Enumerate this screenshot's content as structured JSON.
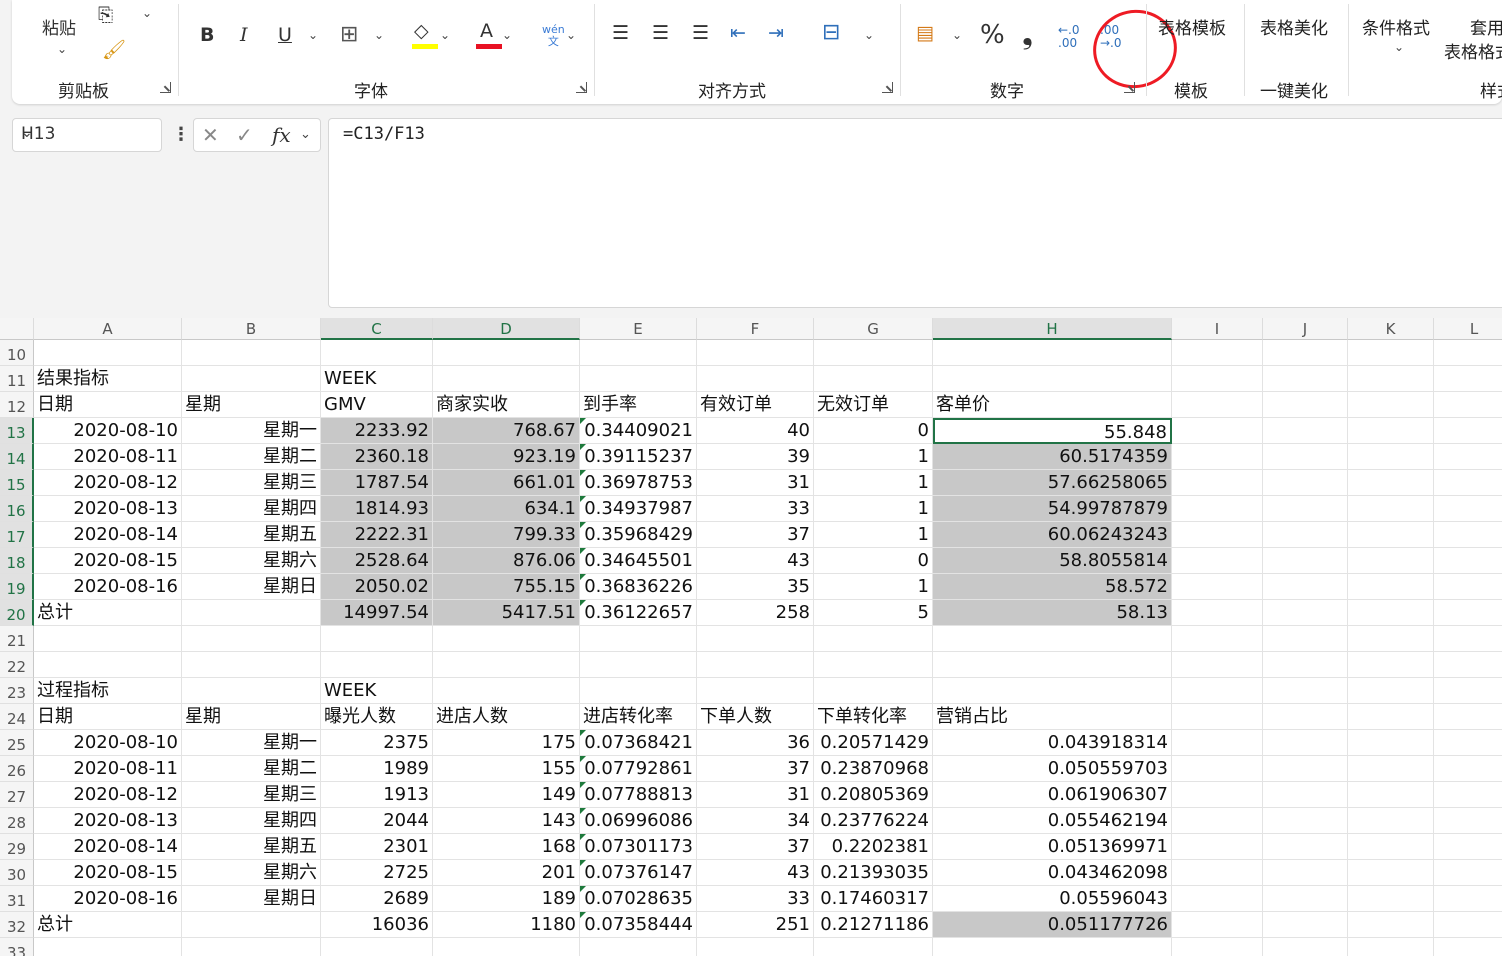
{
  "ribbon": {
    "groups": {
      "clipboard": "剪贴板",
      "font": "字体",
      "align": "对齐方式",
      "number": "数字",
      "template": "模板",
      "beautify": "一键美化",
      "style": "样式"
    },
    "paste_label": "粘贴",
    "bold": "B",
    "italic": "I",
    "underline": "U",
    "font_color_glyph": "A",
    "phonetic_top": "wén",
    "phonetic_bottom": "文",
    "percent": "%",
    "comma": "❟",
    "inc_decimal_top": "←.0",
    "inc_decimal_bottom": ".00",
    "dec_decimal_top": ".00",
    "dec_decimal_bottom": "→.0",
    "table_template": "表格模板",
    "table_beautify": "表格美化",
    "conditional_format": "条件格式",
    "apply_format_top": "套用",
    "apply_format_bottom": "表格格式",
    "highlight_color": "#ffff00",
    "font_color": "#e81123",
    "annotation_color": "#ee1b24"
  },
  "formula_bar": {
    "name_box": "H13",
    "fx": "fx",
    "formula": "=C13/F13"
  },
  "sheet": {
    "columns": [
      "A",
      "B",
      "C",
      "D",
      "E",
      "F",
      "G",
      "H",
      "I",
      "J",
      "K",
      "L"
    ],
    "rows": [
      {
        "n": "10",
        "cells": [
          "",
          "",
          "",
          "",
          "",
          "",
          "",
          ""
        ]
      },
      {
        "n": "11",
        "cells": [
          "结果指标",
          "",
          "WEEK",
          "",
          "",
          "",
          "",
          ""
        ]
      },
      {
        "n": "12",
        "cells": [
          "日期",
          "星期",
          "GMV",
          "商家实收",
          "到手率",
          "有效订单",
          "无效订单",
          "客单价"
        ]
      },
      {
        "n": "13",
        "cells": [
          "2020-08-10",
          "星期一",
          "2233.92",
          "768.67",
          "0.34409021",
          "40",
          "0",
          "55.848"
        ]
      },
      {
        "n": "14",
        "cells": [
          "2020-08-11",
          "星期二",
          "2360.18",
          "923.19",
          "0.39115237",
          "39",
          "1",
          "60.5174359"
        ]
      },
      {
        "n": "15",
        "cells": [
          "2020-08-12",
          "星期三",
          "1787.54",
          "661.01",
          "0.36978753",
          "31",
          "1",
          "57.66258065"
        ]
      },
      {
        "n": "16",
        "cells": [
          "2020-08-13",
          "星期四",
          "1814.93",
          "634.1",
          "0.34937987",
          "33",
          "1",
          "54.99787879"
        ]
      },
      {
        "n": "17",
        "cells": [
          "2020-08-14",
          "星期五",
          "2222.31",
          "799.33",
          "0.35968429",
          "37",
          "1",
          "60.06243243"
        ]
      },
      {
        "n": "18",
        "cells": [
          "2020-08-15",
          "星期六",
          "2528.64",
          "876.06",
          "0.34645501",
          "43",
          "0",
          "58.8055814"
        ]
      },
      {
        "n": "19",
        "cells": [
          "2020-08-16",
          "星期日",
          "2050.02",
          "755.15",
          "0.36836226",
          "35",
          "1",
          "58.572"
        ]
      },
      {
        "n": "20",
        "cells": [
          "总计",
          "",
          "14997.54",
          "5417.51",
          "0.36122657",
          "258",
          "5",
          "58.13"
        ]
      },
      {
        "n": "21",
        "cells": [
          "",
          "",
          "",
          "",
          "",
          "",
          "",
          ""
        ]
      },
      {
        "n": "22",
        "cells": [
          "",
          "",
          "",
          "",
          "",
          "",
          "",
          ""
        ]
      },
      {
        "n": "23",
        "cells": [
          "过程指标",
          "",
          "WEEK",
          "",
          "",
          "",
          "",
          ""
        ]
      },
      {
        "n": "24",
        "cells": [
          "日期",
          "星期",
          "曝光人数",
          "进店人数",
          "进店转化率",
          "下单人数",
          "下单转化率",
          "营销占比"
        ]
      },
      {
        "n": "25",
        "cells": [
          "2020-08-10",
          "星期一",
          "2375",
          "175",
          "0.07368421",
          "36",
          "0.20571429",
          "0.043918314"
        ]
      },
      {
        "n": "26",
        "cells": [
          "2020-08-11",
          "星期二",
          "1989",
          "155",
          "0.07792861",
          "37",
          "0.23870968",
          "0.050559703"
        ]
      },
      {
        "n": "27",
        "cells": [
          "2020-08-12",
          "星期三",
          "1913",
          "149",
          "0.07788813",
          "31",
          "0.20805369",
          "0.061906307"
        ]
      },
      {
        "n": "28",
        "cells": [
          "2020-08-13",
          "星期四",
          "2044",
          "143",
          "0.06996086",
          "34",
          "0.23776224",
          "0.055462194"
        ]
      },
      {
        "n": "29",
        "cells": [
          "2020-08-14",
          "星期五",
          "2301",
          "168",
          "0.07301173",
          "37",
          "0.2202381",
          "0.051369971"
        ]
      },
      {
        "n": "30",
        "cells": [
          "2020-08-15",
          "星期六",
          "2725",
          "201",
          "0.07376147",
          "43",
          "0.21393035",
          "0.043462098"
        ]
      },
      {
        "n": "31",
        "cells": [
          "2020-08-16",
          "星期日",
          "2689",
          "189",
          "0.07028635",
          "33",
          "0.17460317",
          "0.05596043"
        ]
      },
      {
        "n": "32",
        "cells": [
          "总计",
          "",
          "16036",
          "1180",
          "0.07358444",
          "251",
          "0.21271186",
          "0.051177726"
        ]
      },
      {
        "n": "33",
        "cells": [
          "",
          "",
          "",
          "",
          "",
          "",
          "",
          ""
        ]
      }
    ]
  }
}
